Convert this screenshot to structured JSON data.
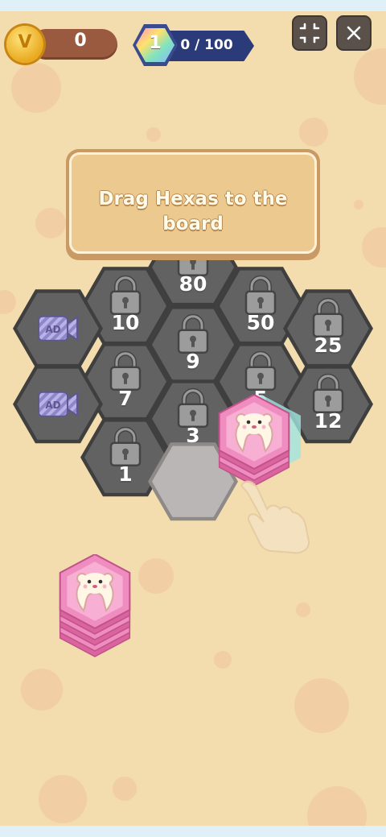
{
  "hud": {
    "coins": "0",
    "coin_symbol": "V",
    "level": "1",
    "progress_text": "0 / 100",
    "fullscreen_icon": "compress-icon",
    "close_icon": "close-icon"
  },
  "tutorial": {
    "message": "Drag Hexas to the board"
  },
  "board": {
    "locked_costs": [
      "80",
      "10",
      "50",
      "9",
      "25",
      "7",
      "5",
      "3",
      "12",
      "1"
    ],
    "ad_label": "AD",
    "icons": {
      "lock": "lock-icon",
      "ad": "ad-video-icon",
      "hand": "pointing-hand-icon"
    }
  },
  "pieces": {
    "tile_name": "hexa-stack-pink",
    "tile_icon": "bear-face-icon"
  },
  "colors": {
    "background": "#f3dcae",
    "locked_cell": "#5f5f5f",
    "empty_cell": "#b9b6b5",
    "piece_pink": "#ef8cc0",
    "banner": "#ecc98f",
    "progress_bar": "#2b3a79"
  }
}
